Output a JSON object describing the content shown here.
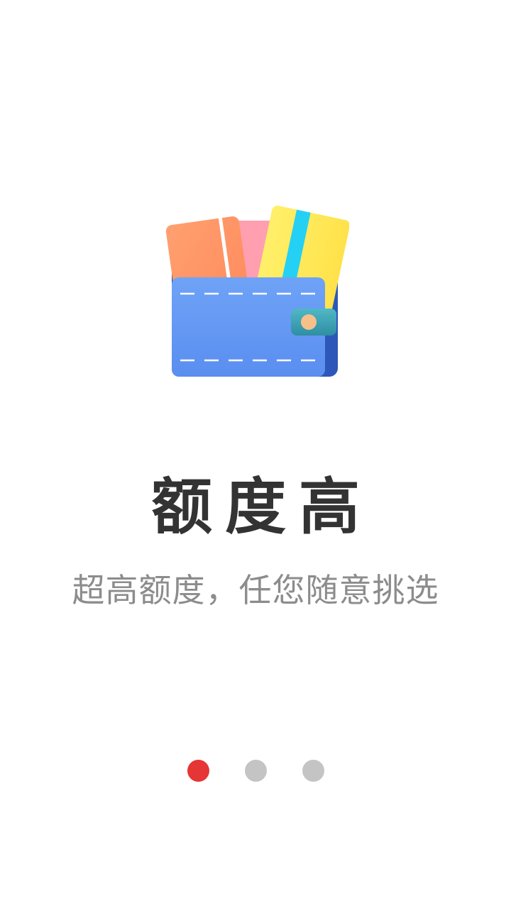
{
  "onboarding": {
    "title": "额度高",
    "subtitle": "超高额度，任您随意挑选",
    "current_page": 1,
    "page_count": 3
  },
  "pager": {
    "dots": [
      {
        "active": true
      },
      {
        "active": false
      },
      {
        "active": false
      }
    ]
  },
  "colors": {
    "active_dot": "#e53535",
    "inactive_dot": "#c4c4c4",
    "title_text": "#333333",
    "subtitle_text": "#8c8c8c",
    "wallet_blue": "#6a9cf5",
    "wallet_dark_blue": "#2d57b8",
    "card_orange": "#ff9a66",
    "card_pink": "#ff9fb0",
    "card_yellow": "#ffe857",
    "card_stripe_cyan": "#25d0f5",
    "clasp_teal": "#3aa3b3",
    "clasp_button": "#f7c08a"
  },
  "illustration": {
    "icon": "wallet-with-cards-icon"
  }
}
